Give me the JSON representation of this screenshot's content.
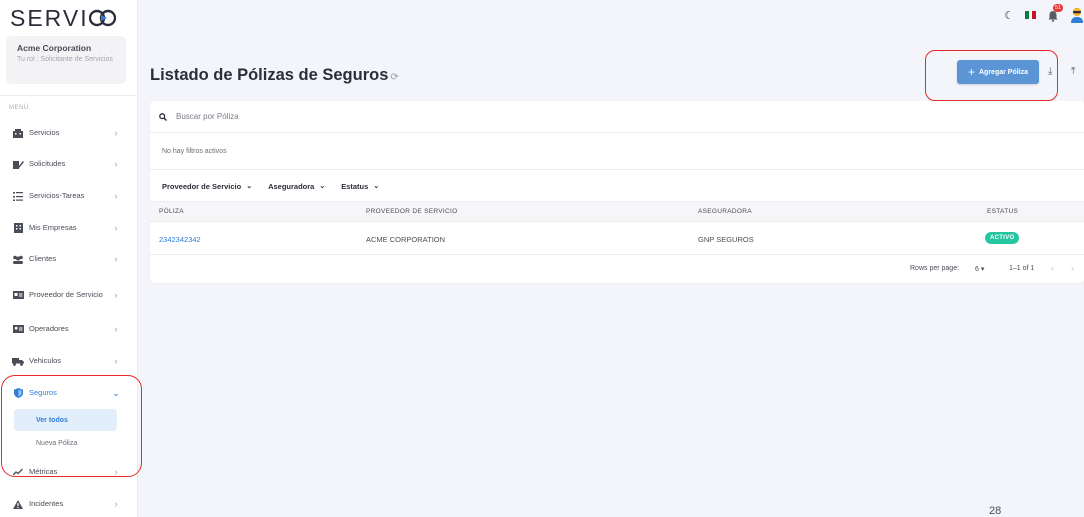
{
  "app": {
    "logo": "SERVIGO"
  },
  "company": {
    "name": "Acme Corporation",
    "role": "Tu rol : Solicitante de Servicios"
  },
  "sidebar": {
    "menu_label": "MENÚ",
    "items": [
      {
        "label": "Servicios",
        "icon": "building-icon"
      },
      {
        "label": "Solicitudes",
        "icon": "edit-request-icon"
      },
      {
        "label": "Servicios-Tareas",
        "icon": "task-list-icon"
      },
      {
        "label": "Mis Empresas",
        "icon": "company-icon"
      },
      {
        "label": "Clientes",
        "icon": "people-icon"
      },
      {
        "label": "Proveedor de Servicio",
        "icon": "id-card-icon"
      },
      {
        "label": "Operadores",
        "icon": "operator-card-icon"
      },
      {
        "label": "Vehiculos",
        "icon": "truck-icon"
      },
      {
        "label": "Seguros",
        "icon": "shield-icon"
      },
      {
        "label": "Métricas",
        "icon": "chart-icon"
      },
      {
        "label": "Incidentes",
        "icon": "warning-icon"
      }
    ],
    "seguros_sub": [
      {
        "label": "Ver todos"
      },
      {
        "label": "Nueva Póliza"
      }
    ]
  },
  "topbar": {
    "notifications_count": "51"
  },
  "page": {
    "title": "Listado de Pólizas de Seguros",
    "add_button": "Agregar Póliza",
    "search_placeholder": "Buscar por Póliza",
    "no_filters": "No hay filtros activos",
    "filters": [
      "Proveedor de Servicio",
      "Aseguradora",
      "Estatus"
    ]
  },
  "table": {
    "columns": [
      "PÓLIZA",
      "PROVEEDOR DE SERVICIO",
      "ASEGURADORA",
      "ESTATUS"
    ],
    "rows": [
      {
        "poliza": "2342342342",
        "proveedor": "ACME CORPORATION",
        "aseguradora": "GNP SEGUROS",
        "estatus": "ACTIVO"
      }
    ]
  },
  "pagination": {
    "rows_label": "Rows per page:",
    "rows_value": "6",
    "range": "1–1 of 1"
  },
  "footer": {
    "page_number": "28"
  },
  "colors": {
    "accent": "#2f7ed8",
    "button": "#5b95d6",
    "status_active": "#26c6a0",
    "highlight": "#e52a2a"
  }
}
